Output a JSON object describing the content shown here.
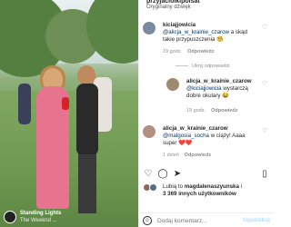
{
  "header": {
    "username": "przyjaciolkipolsat",
    "audio": "Oryginalny dźwięk"
  },
  "comments": [
    {
      "user": "kiciajjowicia",
      "mention": "@alicja_w_krainie_czarow",
      "text": " a skąd takie przypuszczenia 🧐",
      "time": "19 godz.",
      "reply": "Odpowiedz"
    },
    {
      "user": "alicja_w_krainie_czarow",
      "mention": "@kiciajjowicia",
      "text": " wystarczą dobre okulary 😂",
      "time": "19 godz.",
      "reply": "Odpowiedz"
    },
    {
      "user": "alicja_w_krainie_czarow",
      "mention": "@malgosia_socha",
      "text": " w ciąży! Aaaa super ❤️❤️",
      "time": "1 dzień",
      "reply": "Odpowiedz"
    }
  ],
  "hide_replies": "Ukryj odpowiedzi",
  "likes": {
    "prefix": "Lubią to ",
    "user": "magdalenaszyunska",
    "middle": " i",
    "count": "3 369 innych użytkowników"
  },
  "date": "",
  "add_comment": {
    "placeholder": "Dodaj komentarz...",
    "post_label": "Opublikuj"
  },
  "song": {
    "title": "Standing Lights",
    "artist": "The Weeknd ..."
  },
  "icons": {
    "heart": "heart-icon",
    "comment": "comment-icon",
    "share": "share-icon",
    "save": "bookmark-icon",
    "emoji": "emoji-icon"
  }
}
